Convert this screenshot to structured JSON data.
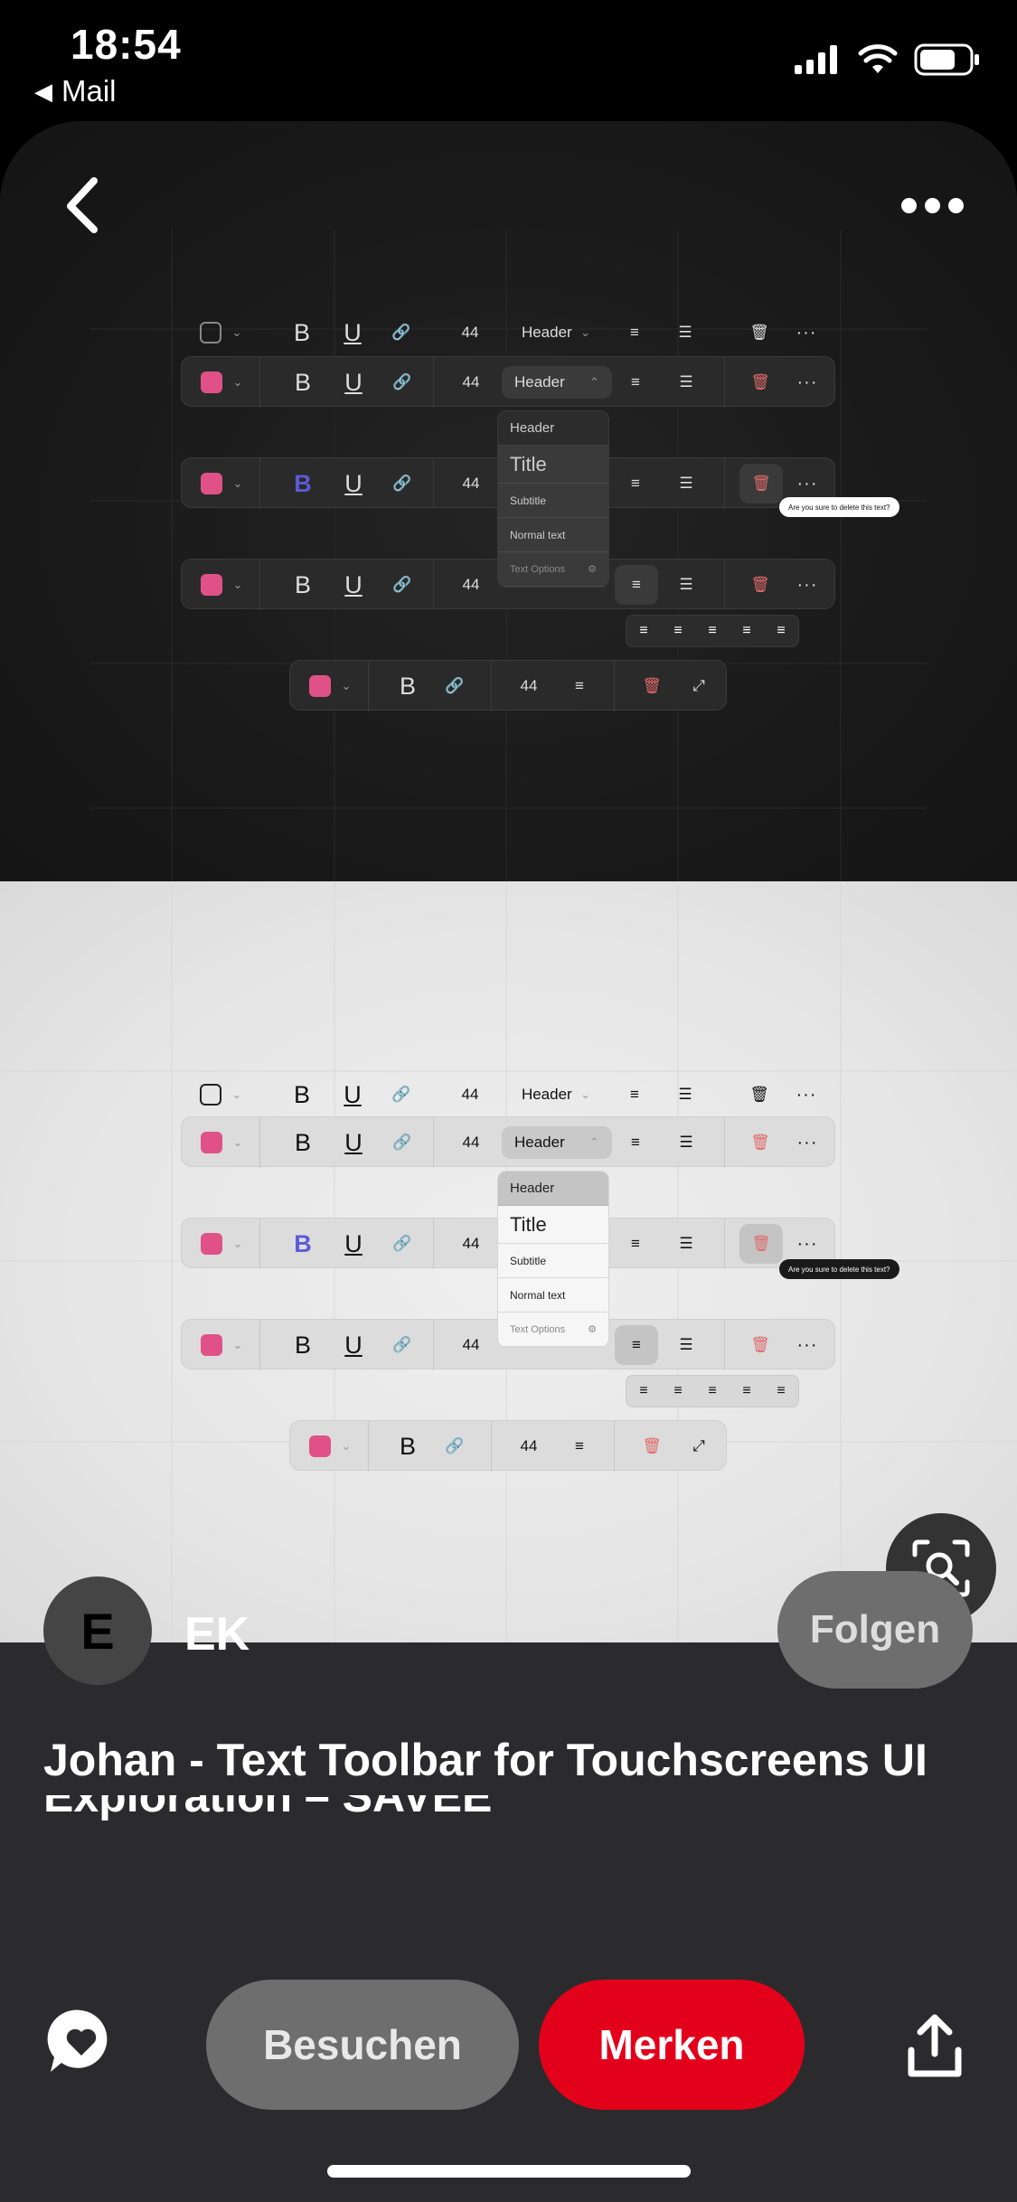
{
  "status_bar": {
    "time": "18:54",
    "back_app": "Mail"
  },
  "toolbar_image": {
    "number": "44",
    "header": "Header",
    "dropdown": [
      "Header",
      "Title",
      "Subtitle",
      "Normal text",
      "Text Options"
    ],
    "tooltip": "Are you sure to delete this text?",
    "bold": "B",
    "underline": "U"
  },
  "pin": {
    "avatar_letter": "E",
    "username": "EK",
    "follow_label": "Folgen",
    "title_line1": "Johan - Text Toolbar for Touchscreens UI",
    "title_line2": "Exploration – SAVEE"
  },
  "actions": {
    "visit_label": "Besuchen",
    "save_label": "Merken"
  },
  "colors": {
    "save_red": "#e3001b",
    "swatch_pink": "#e05287",
    "bold_blue": "#5b5bd6"
  },
  "icons": [
    "back-arrow-icon",
    "more-icon",
    "lens-icon",
    "comment-heart-icon",
    "share-icon",
    "link-icon",
    "trash-icon",
    "align-icon",
    "list-icon",
    "expand-icon"
  ]
}
